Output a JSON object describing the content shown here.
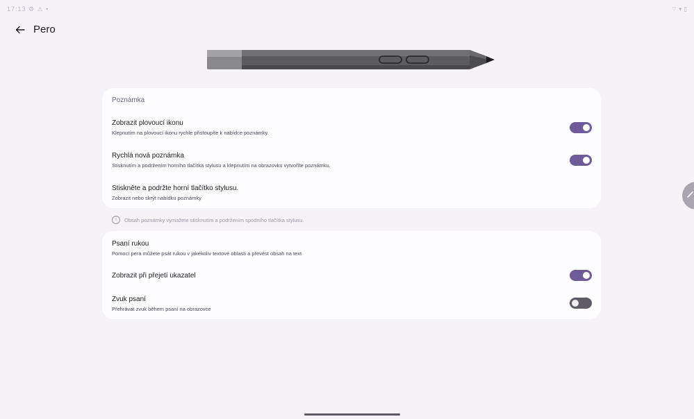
{
  "status_bar": {
    "left_icons": "17:13 ⚙ ⚠ •",
    "right_icons": "⌔ ▾ ▯"
  },
  "app_bar": {
    "title": "Pero",
    "back_icon": "arrow-left-icon"
  },
  "note_section": {
    "title": "Poznámka",
    "items": [
      {
        "title": "Zobrazit plovoucí ikonu",
        "subtitle": "Klepnutím na plovoucí ikonu rychle přistoupíte k nabídce poznámky.",
        "toggle": true
      },
      {
        "title": "Rychlá nová poznámka",
        "subtitle": "Stisknutím a podržením horního tlačítka stylusu a klepnutím na obrazovku vytvoříte poznámku.",
        "toggle": true
      },
      {
        "title": "Stiskněte a podržte horní tlačítko stylusu.",
        "subtitle": "Zobrazit nebo skrýt nabídku poznámky"
      }
    ],
    "info": "Obsah poznámky vymažete stisknutím a podržením spodního tlačítka stylusu."
  },
  "handwriting_section": {
    "items": [
      {
        "title": "Psaní rukou",
        "subtitle": "Pomocí pera můžete psát rukou v jakékoliv textové oblasti a převést obsah na text"
      },
      {
        "title": "Zobrazit při přejetí ukazatel",
        "toggle": true
      },
      {
        "title": "Zvuk psaní",
        "subtitle": "Přehrávat zvuk během psaní na obrazovce",
        "toggle": false
      }
    ]
  },
  "colors": {
    "accent": "#6e5b98",
    "background": "#f5f3f8",
    "card": "#fdfcff"
  }
}
